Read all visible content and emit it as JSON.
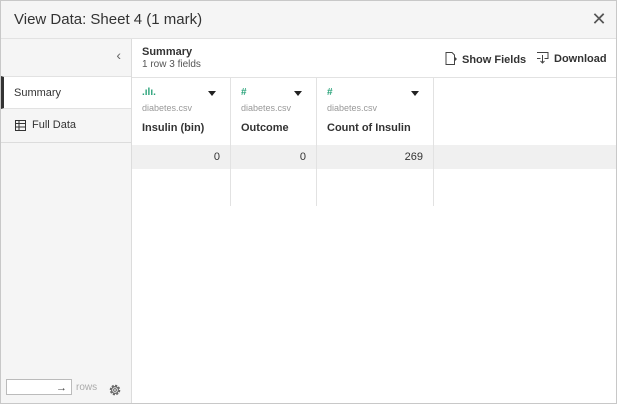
{
  "window": {
    "title": "View Data: Sheet 4 (1 mark)",
    "close_glyph": "✕"
  },
  "sidebar": {
    "collapse_glyph": "‹",
    "items": [
      {
        "label": "Summary",
        "active": true
      },
      {
        "label": "Full Data",
        "icon": "table-icon"
      }
    ],
    "rows_input": {
      "value": "",
      "placeholder": ""
    },
    "rows_arrow": "→",
    "rows_label": "rows",
    "settings_icon": "gear-icon"
  },
  "summary": {
    "title": "Summary",
    "subtitle": "1 row  3 fields"
  },
  "toolbar": {
    "show_fields_label": "Show Fields",
    "download_label": "Download"
  },
  "table": {
    "columns": [
      {
        "type_icon": "histogram-icon",
        "type_glyph": ".ılı.",
        "source": "diabetes.csv",
        "name": "Insulin (bin)"
      },
      {
        "type_icon": "number-icon",
        "type_glyph": "#",
        "source": "diabetes.csv",
        "name": "Outcome"
      },
      {
        "type_icon": "number-icon",
        "type_glyph": "#",
        "source": "diabetes.csv",
        "name": "Count of Insulin"
      }
    ],
    "rows": [
      [
        "0",
        "0",
        "269"
      ]
    ]
  },
  "colors": {
    "type_icon": "#2aa37a",
    "row_background": "#f0f0f0",
    "panel_background": "#f5f5f5"
  }
}
